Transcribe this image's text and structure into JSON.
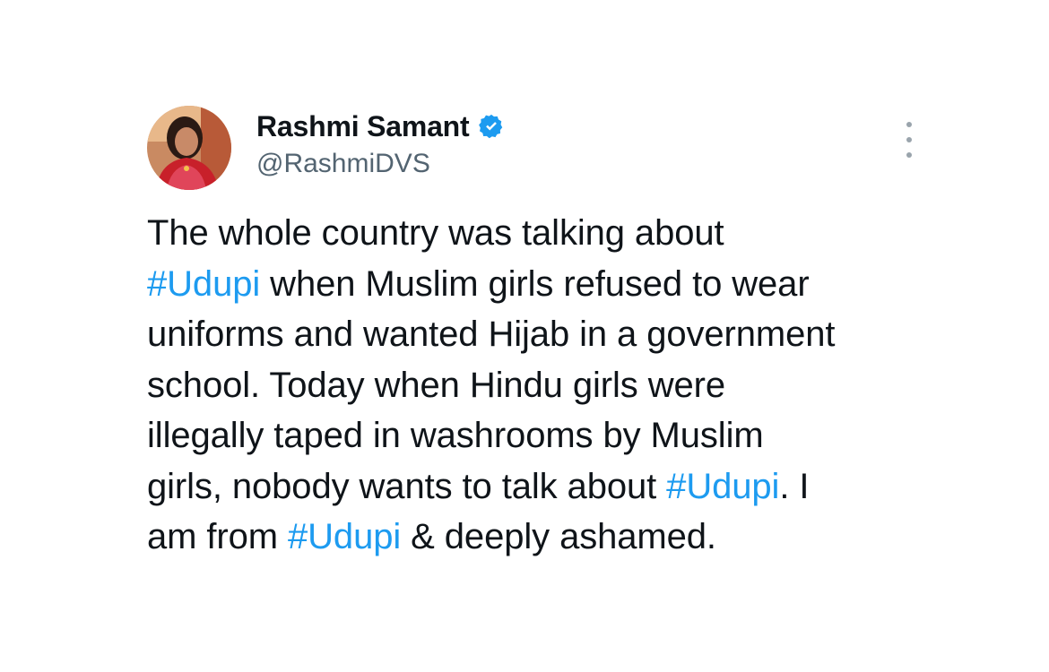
{
  "author": {
    "display_name": "Rashmi Samant",
    "handle": "@RashmiDVS",
    "verified": true,
    "verified_icon": "verified-badge-icon",
    "avatar_icon": "profile-photo"
  },
  "menu": {
    "icon": "more-options-icon"
  },
  "tweet": {
    "lines": [
      [
        {
          "t": "The whole country was talking about",
          "tag": false
        }
      ],
      [
        {
          "t": "#Udupi",
          "tag": true
        },
        {
          "t": " when Muslim girls refused to wear",
          "tag": false
        }
      ],
      [
        {
          "t": "uniforms and wanted Hijab in a government",
          "tag": false
        }
      ],
      [
        {
          "t": "school. Today when Hindu girls were",
          "tag": false
        }
      ],
      [
        {
          "t": "illegally taped in washrooms by Muslim",
          "tag": false
        }
      ],
      [
        {
          "t": "girls, nobody wants to talk about ",
          "tag": false
        },
        {
          "t": "#Udupi",
          "tag": true
        },
        {
          "t": ". I",
          "tag": false
        }
      ],
      [
        {
          "t": "am from ",
          "tag": false
        },
        {
          "t": "#Udupi",
          "tag": true
        },
        {
          "t": " & deeply ashamed.",
          "tag": false
        }
      ]
    ]
  },
  "colors": {
    "text": "#0f1419",
    "secondary": "#536471",
    "accent": "#1d9bf0",
    "background": "#ffffff"
  }
}
